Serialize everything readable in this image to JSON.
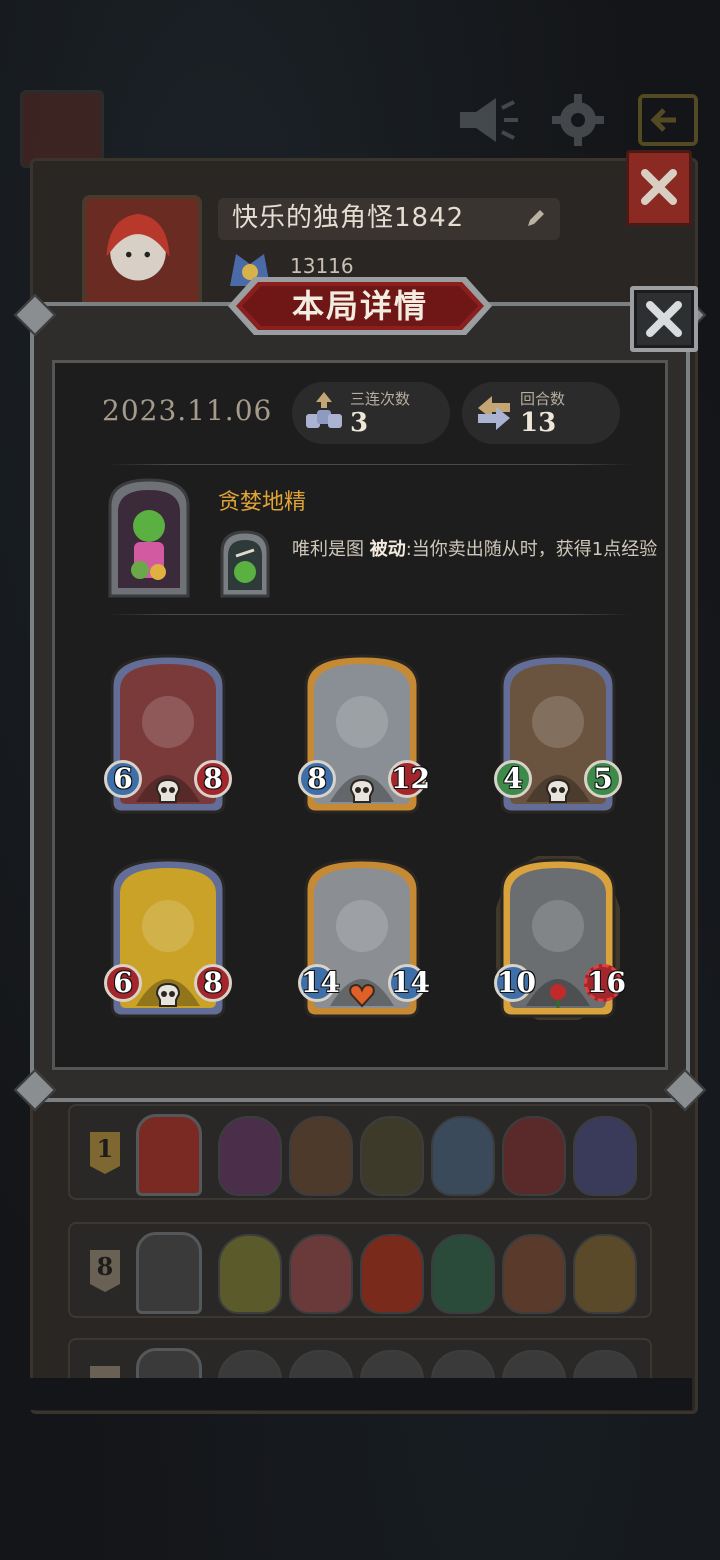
{
  "profile": {
    "player_name": "快乐的独角怪1842",
    "score": "13116"
  },
  "modal": {
    "title": "本局详情",
    "date": "2023.11.06",
    "stats": [
      {
        "label": "三连次数",
        "value": "3",
        "icon": "triple-icon"
      },
      {
        "label": "回合数",
        "value": "13",
        "icon": "turn-icon"
      }
    ],
    "hero": {
      "name": "贪婪地精",
      "power_name": "唯利是图",
      "power_type": "被动",
      "power_desc": ":当你卖出随从时，获得1点经验"
    },
    "minions": [
      {
        "attack": "6",
        "health": "8",
        "frame": "blue",
        "art_color": "#7a3a3a",
        "atk_color": "#3e6fa8",
        "hp_color": "#a2262b",
        "skull": true
      },
      {
        "attack": "8",
        "health": "12",
        "frame": "gold",
        "art_color": "#8a8f95",
        "atk_color": "#3e6fa8",
        "hp_color": "#a2262b",
        "skull": true
      },
      {
        "attack": "4",
        "health": "5",
        "frame": "blue",
        "art_color": "#6a5440",
        "atk_color": "#3d8a4a",
        "hp_color": "#3d8a4a",
        "skull": true
      },
      {
        "attack": "6",
        "health": "8",
        "frame": "blue",
        "art_color": "#c9a227",
        "atk_color": "#a2262b",
        "hp_color": "#a2262b",
        "skull": true
      },
      {
        "attack": "14",
        "health": "14",
        "frame": "gold",
        "art_color": "#8b8f94",
        "atk_color": "#3e6fa8",
        "hp_color": "#3e6fa8",
        "heart": true
      },
      {
        "attack": "10",
        "health": "16",
        "frame": "gold-glow",
        "art_color": "#6b6e70",
        "atk_color": "#3e6fa8",
        "hp_color": "#a2262b",
        "shield": true
      }
    ]
  },
  "ranking": [
    {
      "rank": "1",
      "rank_color": "#c59a3a",
      "hero_color": "#7a2a22",
      "minion_colors": [
        "#4a2e4a",
        "#4e3a2a",
        "#3e3a2a",
        "#3a4a5a",
        "#5a2a2a",
        "#3a3a5a"
      ]
    },
    {
      "rank": "8",
      "rank_color": "#9a8f7a",
      "hero_color": "#3a3a3a",
      "minion_colors": [
        "#5a5a2a",
        "#6a3a3a",
        "#7a2a1a",
        "#2a4a3a",
        "#5a3a2a",
        "#5a4a2a"
      ]
    },
    {
      "rank": "",
      "rank_color": "#9a8f7a",
      "hero_color": "#3a3a3a",
      "minion_colors": [
        "#3a3a3a",
        "#3a3a3a",
        "#3a3a3a",
        "#3a3a3a",
        "#3a3a3a",
        "#3a3a3a"
      ]
    }
  ]
}
